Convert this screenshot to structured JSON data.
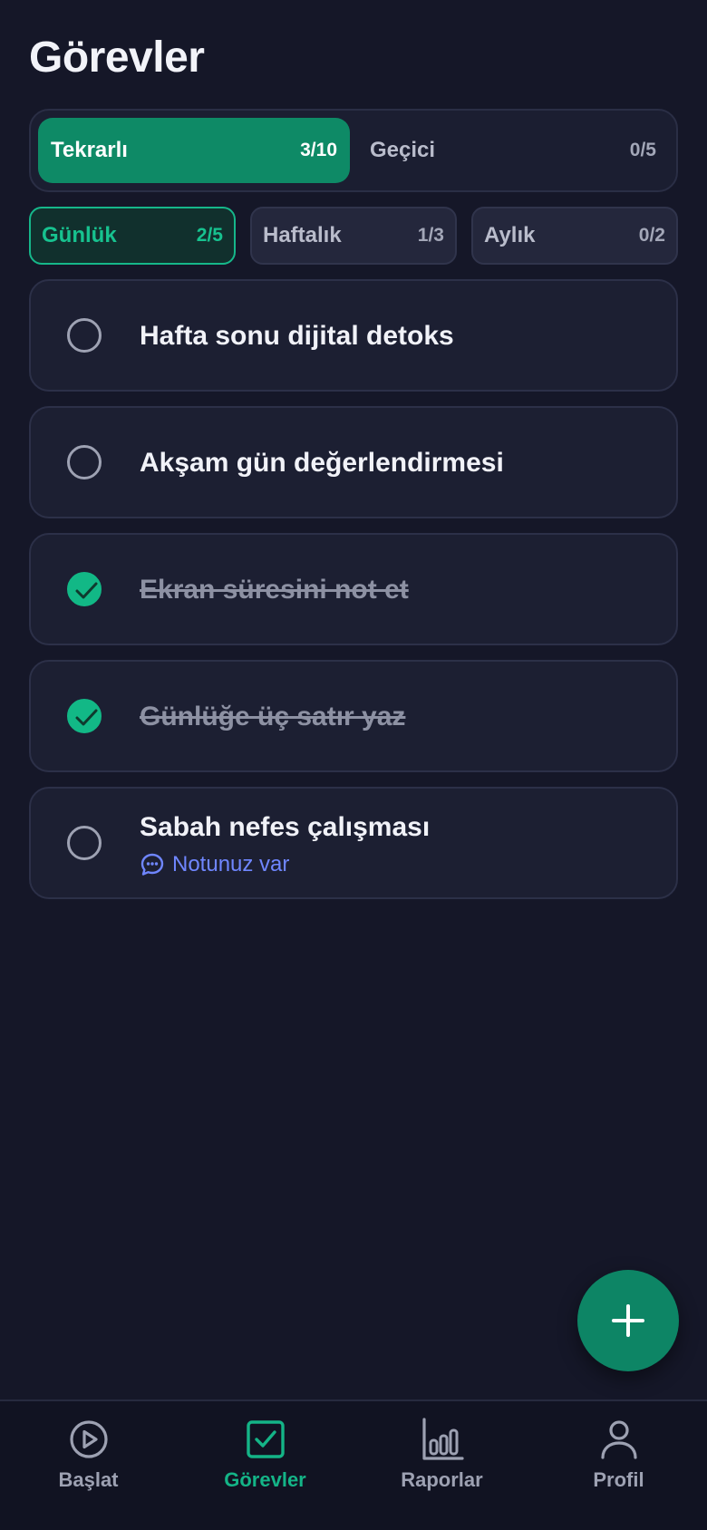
{
  "header": {
    "title": "Görevler"
  },
  "segments": [
    {
      "label": "Tekrarlı",
      "count": "3/10",
      "active": true
    },
    {
      "label": "Geçici",
      "count": "0/5",
      "active": false
    }
  ],
  "periods": [
    {
      "label": "Günlük",
      "count": "2/5",
      "active": true
    },
    {
      "label": "Haftalık",
      "count": "1/3",
      "active": false
    },
    {
      "label": "Aylık",
      "count": "0/2",
      "active": false
    }
  ],
  "tasks": [
    {
      "title": "Hafta sonu dijital detoks",
      "done": false
    },
    {
      "title": "Akşam gün değerlendirmesi",
      "done": false
    },
    {
      "title": "Ekran süresini not et",
      "done": true
    },
    {
      "title": "Günlüğe üç satır yaz",
      "done": true
    },
    {
      "title": "Sabah nefes çalışması",
      "done": false,
      "note": "Notunuz var"
    }
  ],
  "fab": {
    "icon": "plus-icon"
  },
  "bottom_nav": [
    {
      "label": "Başlat",
      "icon": "play-circle-icon",
      "active": false
    },
    {
      "label": "Görevler",
      "icon": "checkbox-icon",
      "active": true
    },
    {
      "label": "Raporlar",
      "icon": "bar-chart-icon",
      "active": false
    },
    {
      "label": "Profil",
      "icon": "user-icon",
      "active": false
    }
  ],
  "colors": {
    "background": "#151728",
    "accent": "#0e8a66",
    "accent_text": "#17c28f",
    "note_link": "#6f86ff"
  }
}
